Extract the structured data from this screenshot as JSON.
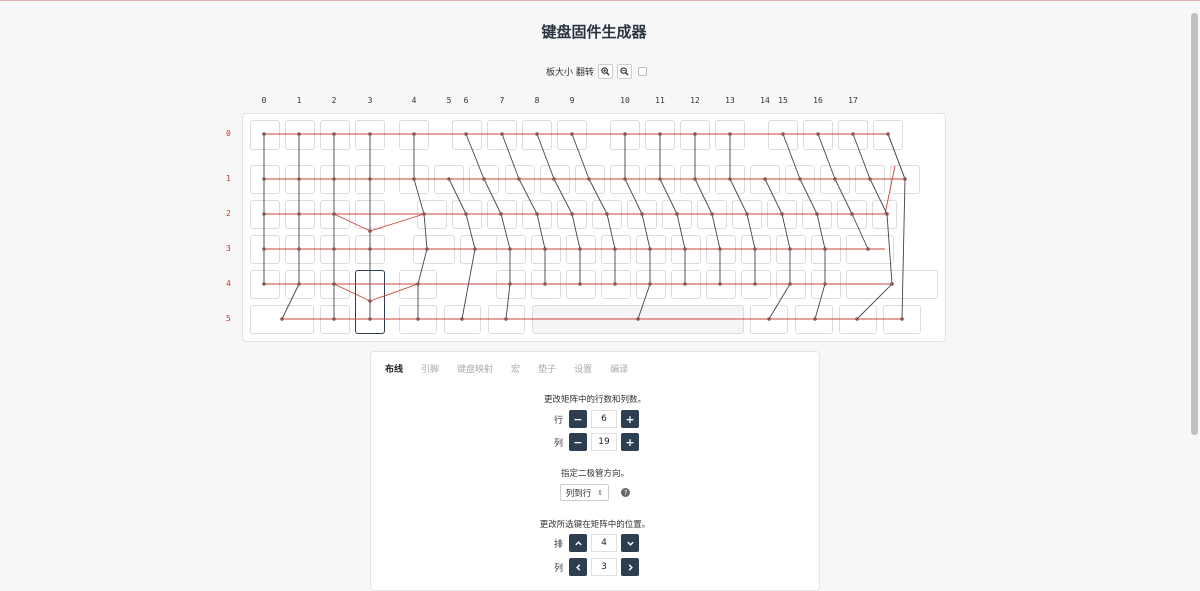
{
  "page": {
    "title": "键盘固件生成器"
  },
  "toolbar": {
    "label": "板大小 翻转",
    "zoom_in_icon": "zoom-in-icon",
    "zoom_out_icon": "zoom-out-icon",
    "flip_checked": false
  },
  "matrix": {
    "col_labels": [
      "0",
      "1",
      "2",
      "3",
      "4",
      "5",
      "6",
      "7",
      "8",
      "9",
      "10",
      "11",
      "12",
      "13",
      "14",
      "15",
      "16",
      "17"
    ],
    "row_labels": [
      "0",
      "1",
      "2",
      "3",
      "4",
      "5"
    ],
    "wire_color": "#c9443b",
    "col_wire_color": "#444444"
  },
  "tabs": [
    {
      "label": "布线",
      "active": true
    },
    {
      "label": "引脚",
      "active": false
    },
    {
      "label": "键盘映射",
      "active": false
    },
    {
      "label": "宏",
      "active": false
    },
    {
      "label": "垫子",
      "active": false
    },
    {
      "label": "设置",
      "active": false
    },
    {
      "label": "编译",
      "active": false
    }
  ],
  "wiring": {
    "matrix_size_hint": "更改矩阵中的行数和列数。",
    "rows_label": "行",
    "rows_value": "6",
    "cols_label": "列",
    "cols_value": "19",
    "diode_hint": "指定二极管方向。",
    "diode_value": "列到行",
    "position_hint": "更改所选键在矩阵中的位置。",
    "pos_row_label": "排",
    "pos_row_value": "4",
    "pos_col_label": "列",
    "pos_col_value": "3"
  },
  "icons": {
    "minus": "−",
    "plus": "+",
    "up": "⌃",
    "down": "⌄",
    "left": "‹",
    "right": "›",
    "help": "?"
  }
}
